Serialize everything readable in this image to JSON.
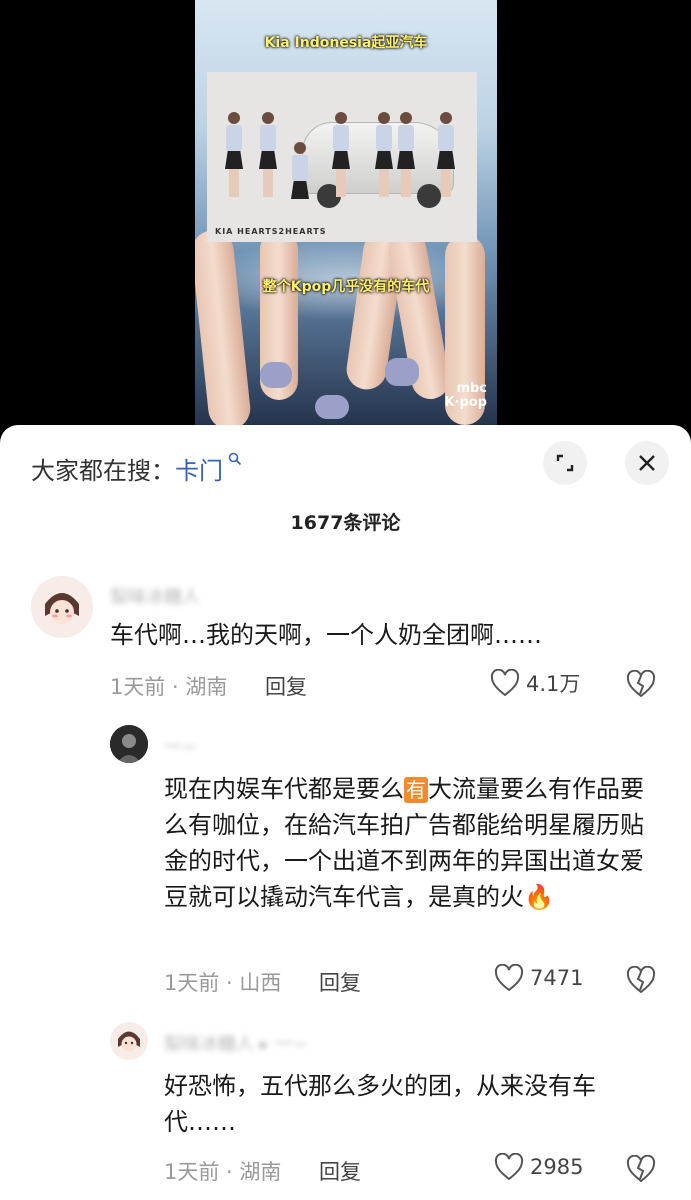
{
  "video": {
    "subtitle_top": "Kia Indonesia起亚汽车",
    "subtitle_mid": "整个Kpop几乎没有的车代",
    "ad_logos": "KIA  HEARTS2HEARTS",
    "watermark_line1": "mbc",
    "watermark_line2": "K·pop"
  },
  "sheet": {
    "search_prefix": "大家都在搜：",
    "search_keyword": "卡门",
    "comment_count": "1677条评论"
  },
  "comments": [
    {
      "username": "梨味冰糖人",
      "text": "车代啊…我的天啊，一个人奶全团啊……",
      "time_location": "1天前 · 湖南",
      "reply_label": "回复",
      "likes": "4.1万"
    },
    {
      "username": "一~",
      "text_part1": "现在内娱车代都是要么",
      "emoji": "有",
      "text_part2": "大流量要么有作品要么有咖位，在給汽车拍广告都能给明星履历贴金的时代，一个出道不到两年的异国出道女爱豆就可以撬动汽车代言，是真的火",
      "fire": "🔥",
      "time_location": "1天前 · 山西",
      "reply_label": "回复",
      "likes": "7471"
    },
    {
      "username": "梨味冰糖人 ▸ 一~",
      "text": "好恐怖，五代那么多火的团，从来没有车代……",
      "time_location": "1天前 · 湖南",
      "reply_label": "回复",
      "likes": "2985"
    }
  ]
}
